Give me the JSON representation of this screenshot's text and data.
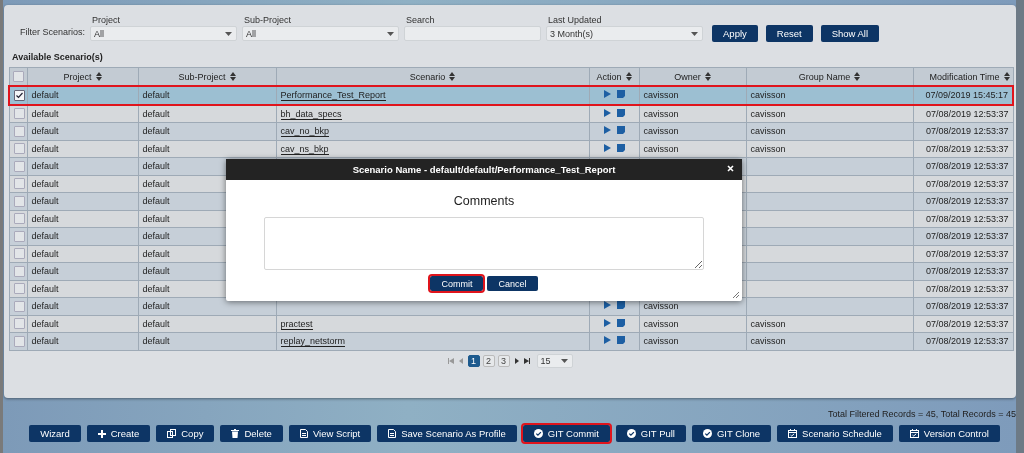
{
  "filters": {
    "label": "Filter Scenarios:",
    "fields": [
      {
        "kind": "select",
        "label": "Project",
        "value": "All"
      },
      {
        "kind": "select",
        "label": "Sub-Project",
        "value": "All"
      },
      {
        "kind": "text",
        "label": "Search"
      },
      {
        "kind": "select",
        "label": "Last Updated",
        "value": "3 Month(s)"
      }
    ],
    "buttons": [
      "Apply",
      "Reset",
      "Show All"
    ]
  },
  "table": {
    "title": "Available Scenario(s)",
    "select_all_checked": false,
    "columns": [
      "Project",
      "Sub-Project",
      "Scenario",
      "Action",
      "Owner",
      "Group Name",
      "Modification Time"
    ],
    "rows": [
      {
        "selected": true,
        "highlighted": true,
        "project": "default",
        "sub_project": "default",
        "scenario": "Performance_Test_Report",
        "owner": "cavisson",
        "group": "cavisson",
        "time": "07/09/2019 15:45:17"
      },
      {
        "selected": false,
        "highlighted": false,
        "project": "default",
        "sub_project": "default",
        "scenario": "bh_data_specs",
        "owner": "cavisson",
        "group": "cavisson",
        "time": "07/08/2019 12:53:37"
      },
      {
        "selected": false,
        "highlighted": false,
        "project": "default",
        "sub_project": "default",
        "scenario": "cav_no_bkp",
        "owner": "cavisson",
        "group": "cavisson",
        "time": "07/08/2019 12:53:37"
      },
      {
        "selected": false,
        "highlighted": false,
        "project": "default",
        "sub_project": "default",
        "scenario": "cav_ns_bkp",
        "owner": "cavisson",
        "group": "cavisson",
        "time": "07/08/2019 12:53:37"
      },
      {
        "selected": false,
        "highlighted": false,
        "project": "default",
        "sub_project": "default",
        "time": "07/08/2019 12:53:37"
      },
      {
        "selected": false,
        "highlighted": false,
        "project": "default",
        "sub_project": "default",
        "time": "07/08/2019 12:53:37"
      },
      {
        "selected": false,
        "highlighted": false,
        "project": "default",
        "sub_project": "default",
        "time": "07/08/2019 12:53:37"
      },
      {
        "selected": false,
        "highlighted": false,
        "project": "default",
        "sub_project": "default",
        "time": "07/08/2019 12:53:37"
      },
      {
        "selected": false,
        "highlighted": false,
        "project": "default",
        "sub_project": "default",
        "time": "07/08/2019 12:53:37"
      },
      {
        "selected": false,
        "highlighted": false,
        "project": "default",
        "sub_project": "default",
        "time": "07/08/2019 12:53:37"
      },
      {
        "selected": false,
        "highlighted": false,
        "project": "default",
        "sub_project": "default",
        "time": "07/08/2019 12:53:37"
      },
      {
        "selected": false,
        "highlighted": false,
        "project": "default",
        "sub_project": "default",
        "time": "07/08/2019 12:53:37"
      },
      {
        "selected": false,
        "highlighted": false,
        "project": "default",
        "sub_project": "default",
        "owner": "cavisson",
        "time": "07/08/2019 12:53:37"
      },
      {
        "selected": false,
        "highlighted": false,
        "project": "default",
        "sub_project": "default",
        "scenario": "practest",
        "owner": "cavisson",
        "group": "cavisson",
        "time": "07/08/2019 12:53:37"
      },
      {
        "selected": false,
        "highlighted": false,
        "project": "default",
        "sub_project": "default",
        "scenario": "replay_netstorm",
        "owner": "cavisson",
        "group": "cavisson",
        "time": "07/08/2019 12:53:37"
      }
    ]
  },
  "pagination": {
    "pages": [
      {
        "label": "1",
        "selected": true
      },
      {
        "label": "2",
        "selected": false
      },
      {
        "label": "3",
        "selected": false
      }
    ],
    "page_size": "15"
  },
  "dialog": {
    "title": "Scenario Name - default/default/Performance_Test_Report",
    "heading": "Comments",
    "buttons": [
      {
        "label": "Commit",
        "highlighted": true
      },
      {
        "label": "Cancel",
        "highlighted": false
      }
    ]
  },
  "totals": "Total Filtered Records = 45, Total Records = 45",
  "actions": [
    {
      "label": "Wizard",
      "kind": "plain",
      "highlighted": false
    },
    {
      "label": "Create",
      "kind": "create",
      "highlighted": false
    },
    {
      "label": "Copy",
      "kind": "copy",
      "highlighted": false
    },
    {
      "label": "Delete",
      "kind": "delete",
      "highlighted": false
    },
    {
      "label": "View Script",
      "kind": "document",
      "highlighted": false
    },
    {
      "label": "Save Scenario As Profile",
      "kind": "document",
      "highlighted": false
    },
    {
      "label": "GIT Commit",
      "kind": "git",
      "highlighted": true
    },
    {
      "label": "GIT Pull",
      "kind": "git",
      "highlighted": false
    },
    {
      "label": "GIT Clone",
      "kind": "git",
      "highlighted": false
    },
    {
      "label": "Scenario Schedule",
      "kind": "schedule",
      "highlighted": false
    },
    {
      "label": "Version Control",
      "kind": "schedule",
      "highlighted": false
    }
  ]
}
